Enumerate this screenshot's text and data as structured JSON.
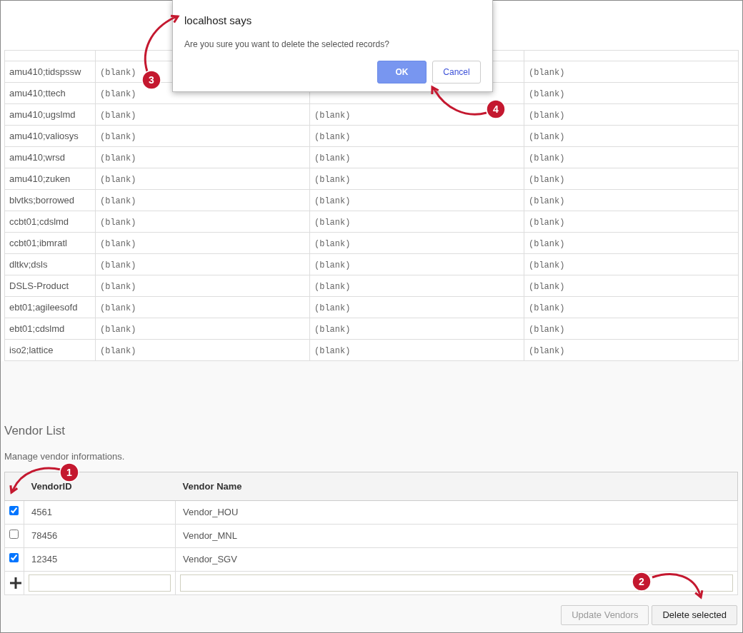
{
  "records": {
    "rows": [
      {
        "cells": [
          "amu410;tidspssw",
          "(blank)",
          null,
          "(blank)"
        ]
      },
      {
        "cells": [
          "amu410;ttech",
          "(blank)",
          null,
          "(blank)"
        ]
      },
      {
        "cells": [
          "amu410;ugslmd",
          "(blank)",
          "(blank)",
          "(blank)"
        ]
      },
      {
        "cells": [
          "amu410;valiosys",
          "(blank)",
          "(blank)",
          "(blank)"
        ]
      },
      {
        "cells": [
          "amu410;wrsd",
          "(blank)",
          "(blank)",
          "(blank)"
        ]
      },
      {
        "cells": [
          "amu410;zuken",
          "(blank)",
          "(blank)",
          "(blank)"
        ]
      },
      {
        "cells": [
          "blvtks;borrowed",
          "(blank)",
          "(blank)",
          "(blank)"
        ]
      },
      {
        "cells": [
          "ccbt01;cdslmd",
          "(blank)",
          "(blank)",
          "(blank)"
        ]
      },
      {
        "cells": [
          "ccbt01;ibmratl",
          "(blank)",
          "(blank)",
          "(blank)"
        ]
      },
      {
        "cells": [
          "dltkv;dsls",
          "(blank)",
          "(blank)",
          "(blank)"
        ]
      },
      {
        "cells": [
          "DSLS-Product",
          "(blank)",
          "(blank)",
          "(blank)"
        ]
      },
      {
        "cells": [
          "ebt01;agileesofd",
          "(blank)",
          "(blank)",
          "(blank)"
        ]
      },
      {
        "cells": [
          "ebt01;cdslmd",
          "(blank)",
          "(blank)",
          "(blank)"
        ]
      },
      {
        "cells": [
          "iso2;lattice",
          "(blank)",
          "(blank)",
          "(blank)"
        ]
      }
    ]
  },
  "vendor_list": {
    "title": "Vendor List",
    "description": "Manage vendor informations.",
    "columns": [
      "VendorID",
      "Vendor Name"
    ],
    "rows": [
      {
        "checked": true,
        "id": "4561",
        "name": "Vendor_HOU"
      },
      {
        "checked": false,
        "id": "78456",
        "name": "Vendor_MNL"
      },
      {
        "checked": true,
        "id": "12345",
        "name": "Vendor_SGV"
      }
    ],
    "buttons": [
      {
        "label": "Update Vendors",
        "disabled": true
      },
      {
        "label": "Delete selected",
        "disabled": false
      }
    ]
  },
  "dialog": {
    "title": "localhost says",
    "message": "Are you sure you want to delete the selected records?",
    "buttons": [
      {
        "label": "OK",
        "kind": "primary"
      },
      {
        "label": "Cancel",
        "kind": "secondary"
      }
    ]
  },
  "callouts": [
    {
      "number": "1"
    },
    {
      "number": "2"
    },
    {
      "number": "3"
    },
    {
      "number": "4"
    }
  ]
}
